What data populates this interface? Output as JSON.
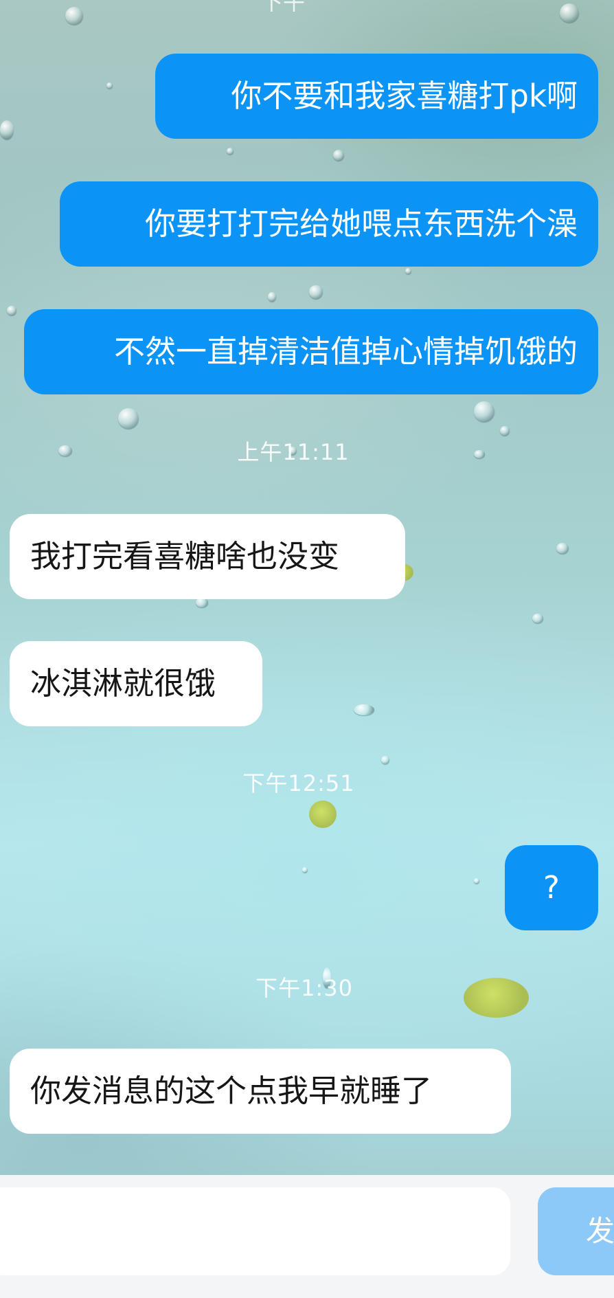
{
  "chat": {
    "top_partial_timestamp": "下午",
    "messages": [
      {
        "direction": "out",
        "text": "你不要和我家喜糖打pk啊"
      },
      {
        "direction": "out",
        "text": "你要打打完给她喂点东西洗个澡"
      },
      {
        "direction": "out",
        "text": "不然一直掉清洁值掉心情掉饥饿的"
      },
      {
        "direction": "in",
        "text": "我打完看喜糖啥也没变"
      },
      {
        "direction": "in",
        "text": "冰淇淋就很饿"
      },
      {
        "direction": "out",
        "text": "?"
      },
      {
        "direction": "in",
        "text": "你发消息的这个点我早就睡了"
      }
    ],
    "timestamps": [
      "上午11:11",
      "下午12:51",
      "下午1:30"
    ]
  },
  "input": {
    "value": "",
    "send_label": "发"
  },
  "colors": {
    "outgoing_bubble": "#0b93f6",
    "incoming_bubble": "#ffffff",
    "send_button": "#8cc8f8"
  }
}
